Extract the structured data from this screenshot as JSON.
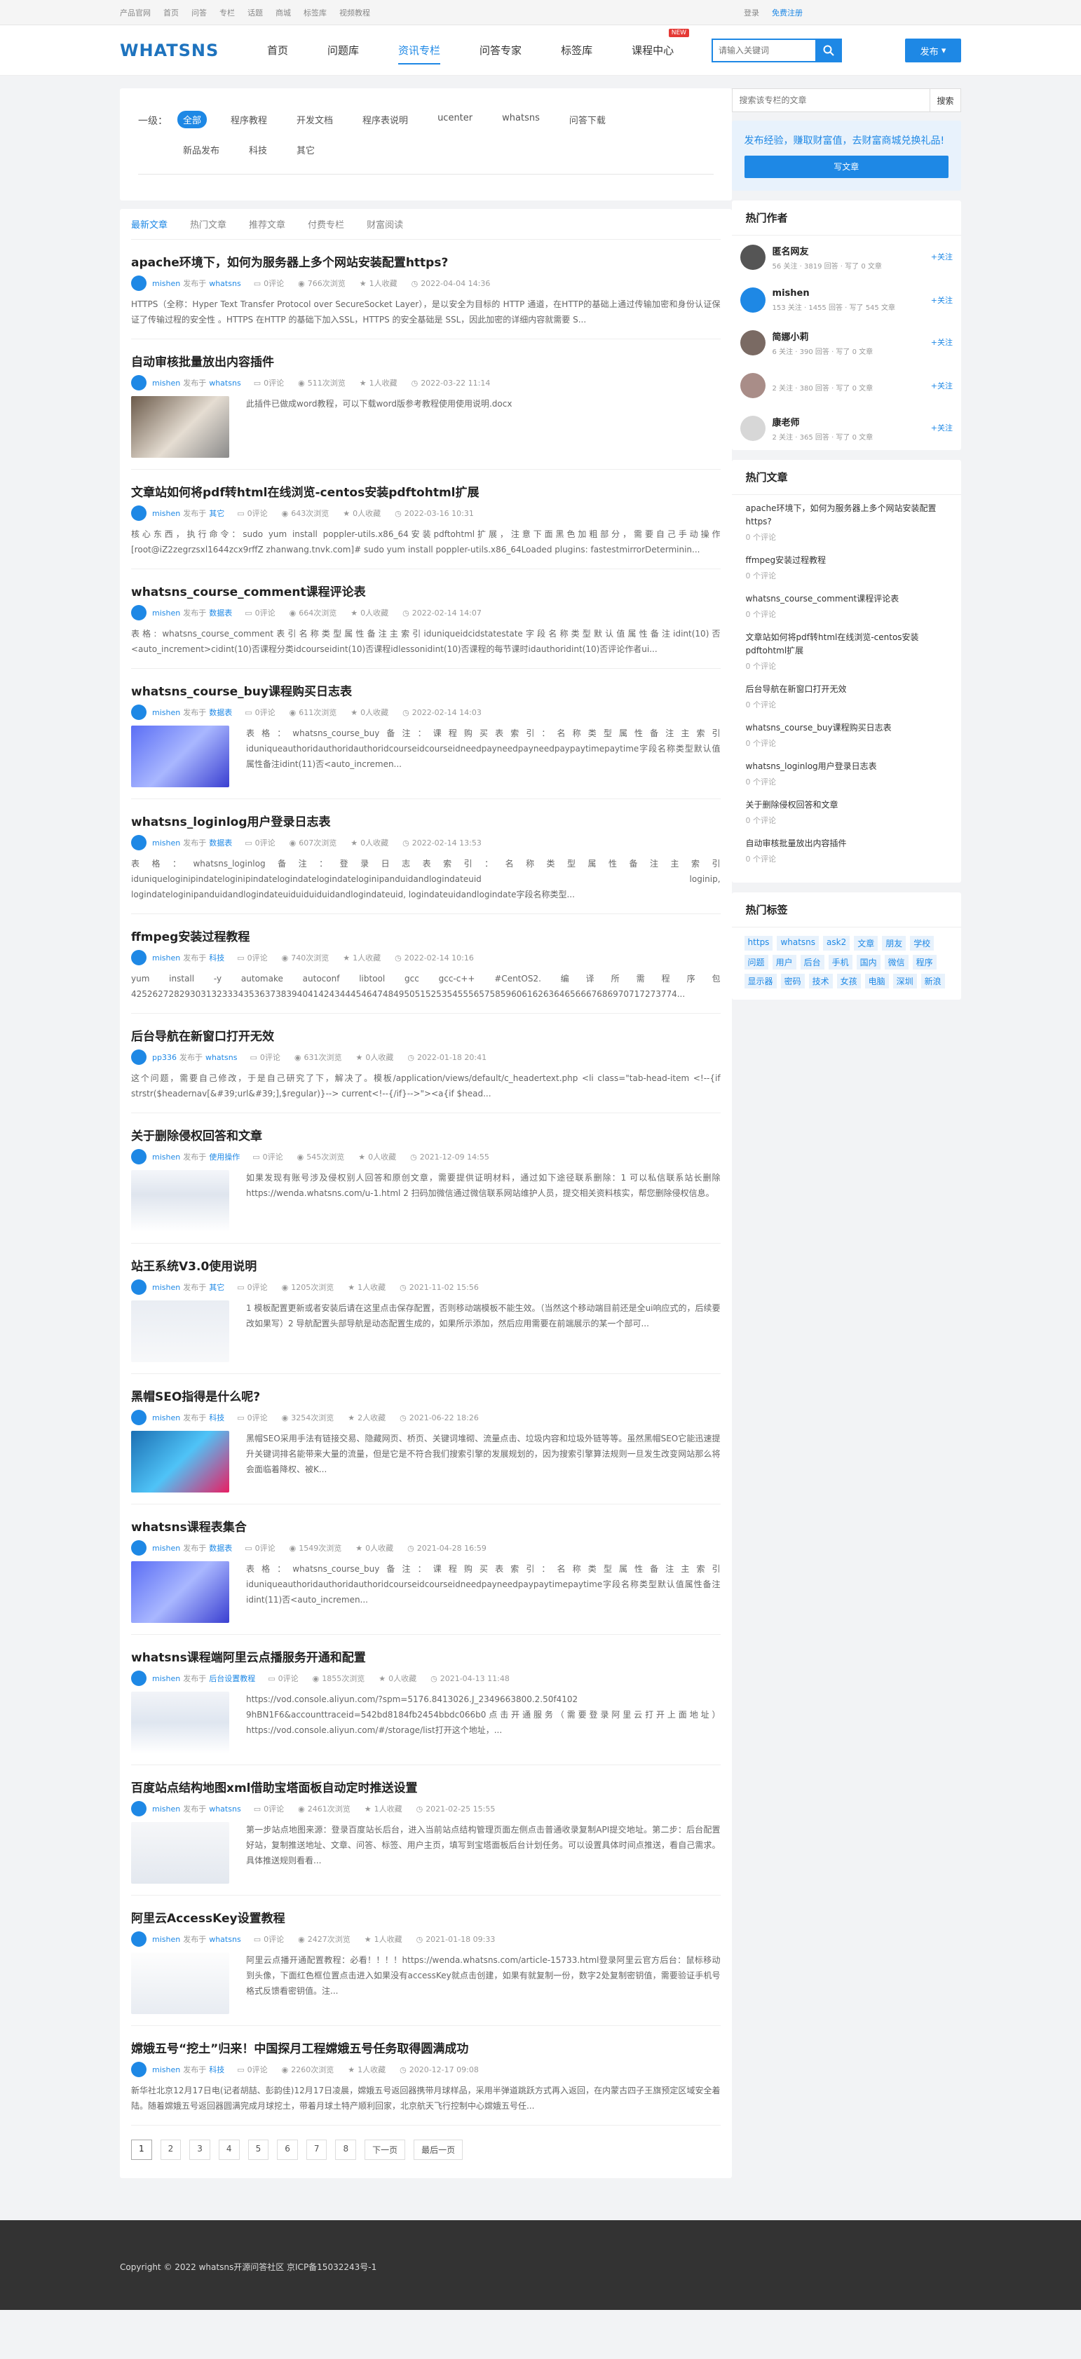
{
  "topbar": {
    "links": [
      "产品官网",
      "首页",
      "问答",
      "专栏",
      "话题",
      "商城",
      "标签库",
      "视频教程"
    ],
    "login": "登录",
    "register": "免费注册"
  },
  "header": {
    "logo": "WHATSNS",
    "nav": [
      "首页",
      "问题库",
      "资讯专栏",
      "问答专家",
      "标签库",
      "课程中心"
    ],
    "new_badge": "NEW",
    "search_placeholder": "请输入关键词",
    "post_label": "发布"
  },
  "filter": {
    "label": "一级：",
    "tags": [
      "全部",
      "程序教程",
      "开发文档",
      "程序表说明",
      "ucenter",
      "whatsns",
      "问答下载",
      "新品发布",
      "科技",
      "其它"
    ]
  },
  "tabs": [
    "最新文章",
    "热门文章",
    "推荐文章",
    "付费专栏",
    "财富阅读"
  ],
  "articles": [
    {
      "title": "apache环境下，如何为服务器上多个网站安装配置https?",
      "author": "mishen",
      "pub": "发布于",
      "cat": "whatsns",
      "comments": "0评论",
      "views": "766次浏览",
      "fav": "1人收藏",
      "date": "2022-04-04 14:36",
      "excerpt": "HTTPS（全称：Hyper Text Transfer Protocol over SecureSocket Layer），是以安全为目标的 HTTP 通道，在HTTP的基础上通过传输加密和身份认证保证了传输过程的安全性 。HTTPS 在HTTP 的基础下加入SSL，HTTPS 的安全基础是 SSL，因此加密的详细内容就需要 S..."
    },
    {
      "title": "自动审核批量放出内容插件",
      "author": "mishen",
      "pub": "发布于",
      "cat": "whatsns",
      "comments": "0评论",
      "views": "511次浏览",
      "fav": "1人收藏",
      "date": "2022-03-22 11:14",
      "excerpt": "此插件已做成word教程，可以下载word版参考教程使用使用说明.docx"
    },
    {
      "title": "文章站如何将pdf转html在线浏览-centos安装pdftohtml扩展",
      "author": "mishen",
      "pub": "发布于",
      "cat": "其它",
      "comments": "0评论",
      "views": "643次浏览",
      "fav": "0人收藏",
      "date": "2022-03-16 10:31",
      "excerpt": "核心东西，执行命令：sudo yum install poppler-utils.x86_64安装pdftohtml扩展，注意下面黑色加粗部分，需要自己手动操作[root@iZ2zegrzsxl1644zcx9rffZ zhanwang.tnvk.com]# sudo yum install poppler-utils.x86_64Loaded plugins: fastestmirrorDeterminin..."
    },
    {
      "title": "whatsns_course_comment课程评论表",
      "author": "mishen",
      "pub": "发布于",
      "cat": "数据表",
      "comments": "0评论",
      "views": "664次浏览",
      "fav": "0人收藏",
      "date": "2022-02-14 14:07",
      "excerpt": "表格: whatsns_course_comment表引名称类型属性备注主索引iduniqueidcidstatestate字段名称类型默认值属性备注idint(10)否<auto_increment>cidint(10)否课程分类idcourseidint(10)否课程idlessonidint(10)否课程的每节课时idauthoridint(10)否评论作者ui..."
    },
    {
      "title": "whatsns_course_buy课程购买日志表",
      "author": "mishen",
      "pub": "发布于",
      "cat": "数据表",
      "comments": "0评论",
      "views": "611次浏览",
      "fav": "0人收藏",
      "date": "2022-02-14 14:03",
      "excerpt": "表格：whatsns_course_buy备注：课程购买表索引：名称类型属性备注主索引iduniqueauthoridauthoridauthoridcourseidcourseidneedpayneedpayneedpaypaytimepaytime字段名称类型默认值属性备注idint(11)否<auto_incremen..."
    },
    {
      "title": "whatsns_loginlog用户登录日志表",
      "author": "mishen",
      "pub": "发布于",
      "cat": "数据表",
      "comments": "0评论",
      "views": "607次浏览",
      "fav": "0人收藏",
      "date": "2022-02-14 13:53",
      "excerpt": "表格：whatsns_loginlog备注：登录日志表索引：名称类型属性备注主索引iduniqueloginipindateloginipindatelogindatelogindateloginipanduidandlogindateuid loginip, logindateloginipanduidandlogindateuiduiduiduidandlogindateuid, logindateuidandlogindate字段名称类型..."
    },
    {
      "title": "ffmpeg安装过程教程",
      "author": "mishen",
      "pub": "发布于",
      "cat": "科技",
      "comments": "0评论",
      "views": "740次浏览",
      "fav": "1人收藏",
      "date": "2022-02-14 10:16",
      "excerpt": "yum install -y automake autoconf libtool gcc gcc-c++ #CentOS2. 编译所需程序包425262728293031323334353637383940414243444546474849505152535455565758596061626364656667686970717273774..."
    },
    {
      "title": "后台导航在新窗口打开无效",
      "author": "pp336",
      "pub": "发布于",
      "cat": "whatsns",
      "comments": "0评论",
      "views": "631次浏览",
      "fav": "0人收藏",
      "date": "2022-01-18 20:41",
      "excerpt": "这个问题，需要自己修改，于是自己研究了下，解决了。模板/application/views/default/c_headertext.php <li class=\"tab-head-item <!--{if strstr($headernav[&#39;url&#39;],$regular)}--> current<!--{/if}-->\"><a{if $head..."
    },
    {
      "title": "关于删除侵权回答和文章",
      "author": "mishen",
      "pub": "发布于",
      "cat": "使用操作",
      "comments": "0评论",
      "views": "545次浏览",
      "fav": "0人收藏",
      "date": "2021-12-09 14:55",
      "excerpt": "如果发现有账号涉及侵权别人回答和原创文章，需要提供证明材料，通过如下途径联系删除：1 可以私信联系站长删除https://wenda.whatsns.com/u-1.html 2 扫码加微信通过微信联系网站维护人员，提交相关资料核实，帮您删除侵权信息。"
    },
    {
      "title": "站王系统V3.0使用说明",
      "author": "mishen",
      "pub": "发布于",
      "cat": "其它",
      "comments": "0评论",
      "views": "1205次浏览",
      "fav": "1人收藏",
      "date": "2021-11-02 15:56",
      "excerpt": "1 模板配置更新或者安装后请在这里点击保存配置，否则移动端模板不能生效。（当然这个移动端目前还是全ui响应式的，后续要改如果写）2 导航配置头部导航是动态配置生成的，如果所示添加，然后应用需要在前端展示的某一个部可..."
    },
    {
      "title": "黑帽SEO指得是什么呢?",
      "author": "mishen",
      "pub": "发布于",
      "cat": "科技",
      "comments": "0评论",
      "views": "3254次浏览",
      "fav": "2人收藏",
      "date": "2021-06-22 18:26",
      "excerpt": "黑帽SEO采用手法有链接交易、隐藏网页、桥页、关键词堆砌、流量点击、垃圾内容和垃圾外链等等。虽然黑帽SEO它能迅速提升关键词排名能带来大量的流量，但是它是不符合我们搜索引擎的发展规划的，因为搜索引擎算法规则一旦发生改变网站那么将会面临着降权、被K..."
    },
    {
      "title": "whatsns课程表集合",
      "author": "mishen",
      "pub": "发布于",
      "cat": "数据表",
      "comments": "0评论",
      "views": "1549次浏览",
      "fav": "0人收藏",
      "date": "2021-04-28 16:59",
      "excerpt": "表格：whatsns_course_buy备注：课程购买表索引：名称类型属性备注主索引iduniqueauthoridauthoridauthoridcourseidcourseidneedpayneedpaypaytimepaytime字段名称类型默认值属性备注idint(11)否<auto_incremen..."
    },
    {
      "title": "whatsns课程端阿里云点播服务开通和配置",
      "author": "mishen",
      "pub": "发布于",
      "cat": "后台设置教程",
      "comments": "0评论",
      "views": "1855次浏览",
      "fav": "0人收藏",
      "date": "2021-04-13 11:48",
      "excerpt": "https://vod.console.aliyun.com/?spm=5176.8413026.J_2349663800.2.50f4102​9hBN1F6&accounttraceid=542bd8184fb2454bbdc066b0点击开通服务（需要登录阿里云打开上面地址）https://vod.console.aliyun.com/#/storage/list打开这个地址，..."
    },
    {
      "title": "百度站点结构地图xml借助宝塔面板自动定时推送设置",
      "author": "mishen",
      "pub": "发布于",
      "cat": "whatsns",
      "comments": "0评论",
      "views": "2461次浏览",
      "fav": "1人收藏",
      "date": "2021-02-25 15:55",
      "excerpt": "第一步站点地图来源：登录百度站长后台，进入当前站点结构管理页面左侧点击普通收录复制API提交地址。第二步：后台配置好站，复制推送地址、文章、问答、标签、用户主页，填写到宝塔面板后台计划任务。可以设置具体时间点推送，看自己需求。具体推送规则看看..."
    },
    {
      "title": "阿里云AccessKey设置教程",
      "author": "mishen",
      "pub": "发布于",
      "cat": "whatsns",
      "comments": "0评论",
      "views": "2427次浏览",
      "fav": "1人收藏",
      "date": "2021-01-18 09:33",
      "excerpt": "阿里云点播开通配置教程：必看！！！！https://wenda.whatsns.com/article-15733.html登录阿里云官方后台：鼠标移动到头像，下面红色框位置点击进入如果没有accessKey就点击创建，如果有就复制一份，数字2处复制密钥值，需要验证手机号格式反馈看密钥值。注..."
    },
    {
      "title": "嫦娥五号“挖土”归来！中国探月工程嫦娥五号任务取得圆满成功",
      "author": "mishen",
      "pub": "发布于",
      "cat": "科技",
      "comments": "0评论",
      "views": "2260次浏览",
      "fav": "1人收藏",
      "date": "2020-12-17 09:08",
      "excerpt": "新华社北京12月17日电(记者胡喆、彭韵佳)12月17日凌晨，嫦娥五号返回器携带月球样品，采用半弹道跳跃方式再入返回，在内蒙古四子王旗预定区域安全着陆。随着嫦娥五号返回器圆满完成月球挖土，带着月球土特产顺利回家，北京航天飞行控制中心嫦娥五号任..."
    }
  ],
  "pager": [
    "1",
    "2",
    "3",
    "4",
    "5",
    "6",
    "7",
    "8",
    "下一页",
    "最后一页"
  ],
  "sidebar": {
    "search_placeholder": "搜索该专栏的文章",
    "search_btn": "搜索",
    "promo_text": "发布经验，赚取财富值，去财富商城兑换礼品!",
    "promo_btn": "写文章",
    "authors_title": "热门作者",
    "authors": [
      {
        "name": "匿名网友",
        "stats": "56 关注 · 3819 回答 · 写了 0 文章",
        "follow": "+关注"
      },
      {
        "name": "mishen",
        "stats": "153 关注 · 1455 回答 · 写了 545 文章",
        "follow": "+关注"
      },
      {
        "name": "简娜小莉",
        "stats": "6 关注 · 390 回答 · 写了 0 文章",
        "follow": "+关注"
      },
      {
        "name": "",
        "stats": "2 关注 · 380 回答 · 写了 0 文章",
        "follow": "+关注"
      },
      {
        "name": "康老师",
        "stats": "2 关注 · 365 回答 · 写了 0 文章",
        "follow": "+关注"
      }
    ],
    "hot_title": "热门文章",
    "hot": [
      {
        "t": "apache环境下，如何为服务器上多个网站安装配置https?",
        "c": "0 个评论"
      },
      {
        "t": "ffmpeg安装过程教程",
        "c": "0 个评论"
      },
      {
        "t": "whatsns_course_comment课程评论表",
        "c": "0 个评论"
      },
      {
        "t": "文章站如何将pdf转html在线浏览-centos安装pdftohtml扩展",
        "c": "0 个评论"
      },
      {
        "t": "后台导航在新窗口打开无效",
        "c": "0 个评论"
      },
      {
        "t": "whatsns_course_buy课程购买日志表",
        "c": "0 个评论"
      },
      {
        "t": "whatsns_loginlog用户登录日志表",
        "c": "0 个评论"
      },
      {
        "t": "关于删除侵权回答和文章",
        "c": "0 个评论"
      },
      {
        "t": "自动审核批量放出内容插件",
        "c": "0 个评论"
      }
    ],
    "tags_title": "热门标签",
    "tags": [
      "https",
      "whatsns",
      "ask2",
      "文章",
      "朋友",
      "学校",
      "问题",
      "用户",
      "后台",
      "手机",
      "国内",
      "微信",
      "程序",
      "显示器",
      "密码",
      "技术",
      "女孩",
      "电脑",
      "深圳",
      "新浪"
    ]
  },
  "footer": "Copyright © 2022 whatsns开源问答社区 京ICP备15032243号-1"
}
